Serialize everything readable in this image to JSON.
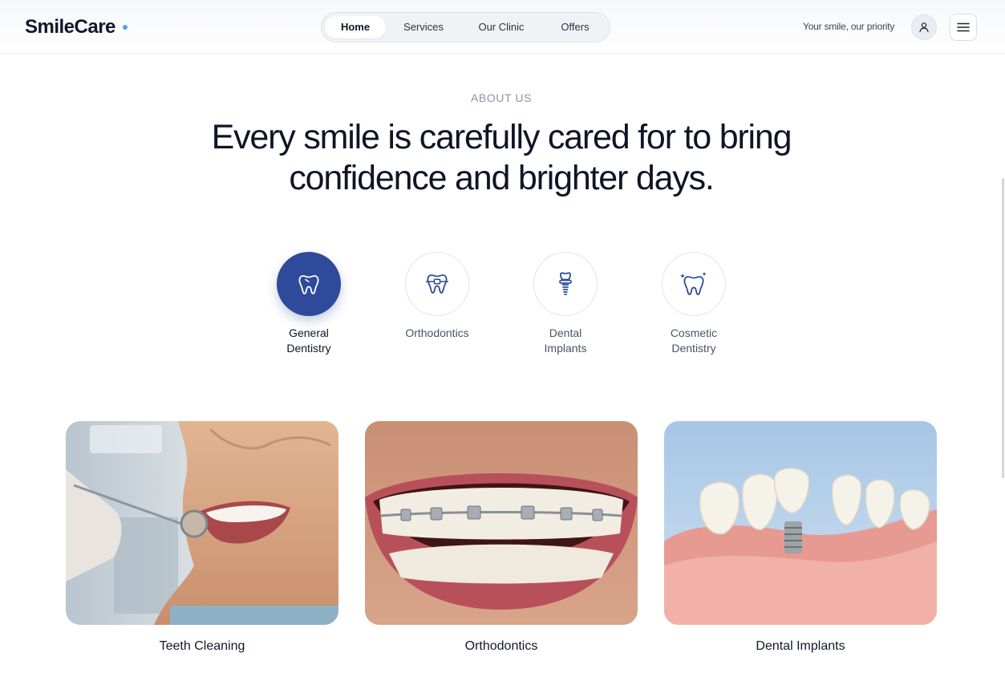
{
  "header": {
    "logo": "SmileCare",
    "nav": [
      "Home",
      "Services",
      "Our Clinic",
      "Offers"
    ],
    "active_nav": "Home",
    "tagline": "Your smile, our priority",
    "icons": {
      "user": "user-icon",
      "menu": "menu-icon"
    }
  },
  "about": {
    "eyebrow": "ABOUT US",
    "headline_line1": "Every smile is carefully cared for to bring",
    "headline_line2": "confidence and brighter days."
  },
  "categories": [
    {
      "line1": "General",
      "line2": "Dentistry",
      "icon": "tooth-icon",
      "active": true
    },
    {
      "line1": "Orthodontics",
      "line2": "",
      "icon": "braces-icon",
      "active": false
    },
    {
      "line1": "Dental",
      "line2": "Implants",
      "icon": "implant-icon",
      "active": false
    },
    {
      "line1": "Cosmetic",
      "line2": "Dentistry",
      "icon": "sparkle-tooth-icon",
      "active": false
    }
  ],
  "cards": [
    {
      "title": "Teeth Cleaning",
      "image": "teeth-cleaning-photo"
    },
    {
      "title": "Orthodontics",
      "image": "braces-photo"
    },
    {
      "title": "Dental Implants",
      "image": "implant-model-photo"
    }
  ],
  "colors": {
    "accent": "#2f4a9a",
    "logo_dot": "#4da3f0",
    "muted": "#8a93a6"
  }
}
